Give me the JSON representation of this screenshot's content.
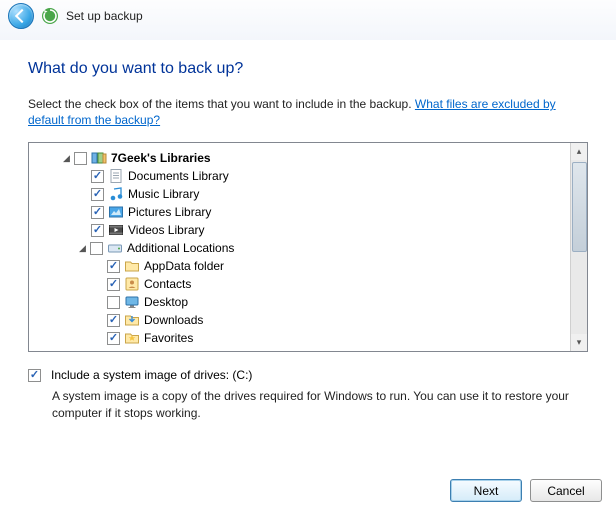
{
  "titlebar": {
    "title": "Set up backup"
  },
  "heading": "What do you want to back up?",
  "description": "Select the check box of the items that you want to include in the backup. ",
  "help_link": "What files are excluded by default from the backup?",
  "tree": {
    "root": {
      "label": "7Geek's Libraries",
      "expanded": true,
      "checked": "unchecked"
    },
    "doc": {
      "label": "Documents Library",
      "checked": "checked"
    },
    "mus": {
      "label": "Music Library",
      "checked": "checked"
    },
    "pic": {
      "label": "Pictures Library",
      "checked": "checked"
    },
    "vid": {
      "label": "Videos Library",
      "checked": "checked"
    },
    "addl": {
      "label": "Additional Locations",
      "expanded": true,
      "checked": "unchecked"
    },
    "appd": {
      "label": "AppData folder",
      "checked": "checked"
    },
    "con": {
      "label": "Contacts",
      "checked": "checked"
    },
    "desk": {
      "label": "Desktop",
      "checked": "unchecked"
    },
    "down": {
      "label": "Downloads",
      "checked": "checked"
    },
    "fav": {
      "label": "Favorites",
      "checked": "checked"
    }
  },
  "system_image": {
    "label": "Include a system image of drives: (C:)",
    "checked": true,
    "note": "A system image is a copy of the drives required for Windows to run. You can use it to restore your computer if it stops working."
  },
  "buttons": {
    "next": "Next",
    "cancel": "Cancel"
  }
}
